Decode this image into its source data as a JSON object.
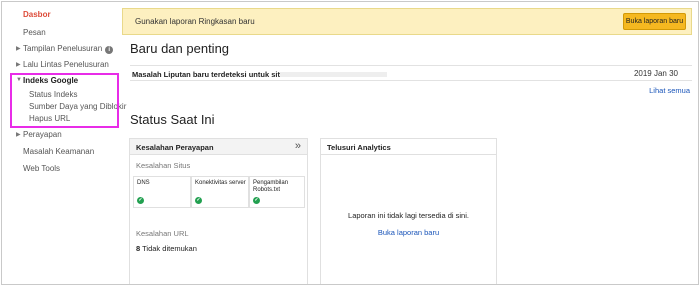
{
  "sidebar": {
    "items": [
      {
        "label": "Dasbor"
      },
      {
        "label": "Pesan"
      },
      {
        "label": "Tampilan Penelusuran"
      },
      {
        "label": "Lalu Lintas Penelusuran"
      },
      {
        "label": "Indeks Google"
      },
      {
        "label": "Perayapan"
      },
      {
        "label": "Masalah Keamanan"
      },
      {
        "label": "Web Tools"
      }
    ],
    "sub_items": [
      {
        "label": "Status Indeks"
      },
      {
        "label": "Sumber Daya yang Diblokir"
      },
      {
        "label": "Hapus URL"
      }
    ],
    "info_icon_glyph": "i",
    "highlight_color": "#e82ce8"
  },
  "banner": {
    "text": "Gunakan laporan Ringkasan baru",
    "button_label": "Buka laporan baru"
  },
  "new_important": {
    "title": "Baru dan penting",
    "issue_text": "Masalah Liputan baru terdeteksi untuk situs",
    "issue_date": "2019 Jan 30",
    "see_all_label": "Lihat semua"
  },
  "status": {
    "title": "Status Saat Ini",
    "crawl_errors": {
      "header": "Kesalahan Perayapan",
      "chevron": "»",
      "site_errors_label": "Kesalahan Situs",
      "cells": [
        {
          "label": "DNS"
        },
        {
          "label": "Konektivitas server"
        },
        {
          "label": "Pengambilan Robots.txt"
        }
      ],
      "check_glyph": "✓",
      "url_errors_label": "Kesalahan URL",
      "not_found_count": "8",
      "not_found_label": "Tidak ditemukan"
    },
    "analytics": {
      "header": "Telusuri Analytics",
      "message": "Laporan ini tidak lagi tersedia di sini.",
      "link_label": "Buka laporan baru"
    }
  },
  "colors": {
    "active_nav": "#dd4b39",
    "link": "#1a55b9",
    "banner_bg": "#fdf0c0",
    "button_bg": "#f5b820",
    "check_green": "#22a050"
  }
}
